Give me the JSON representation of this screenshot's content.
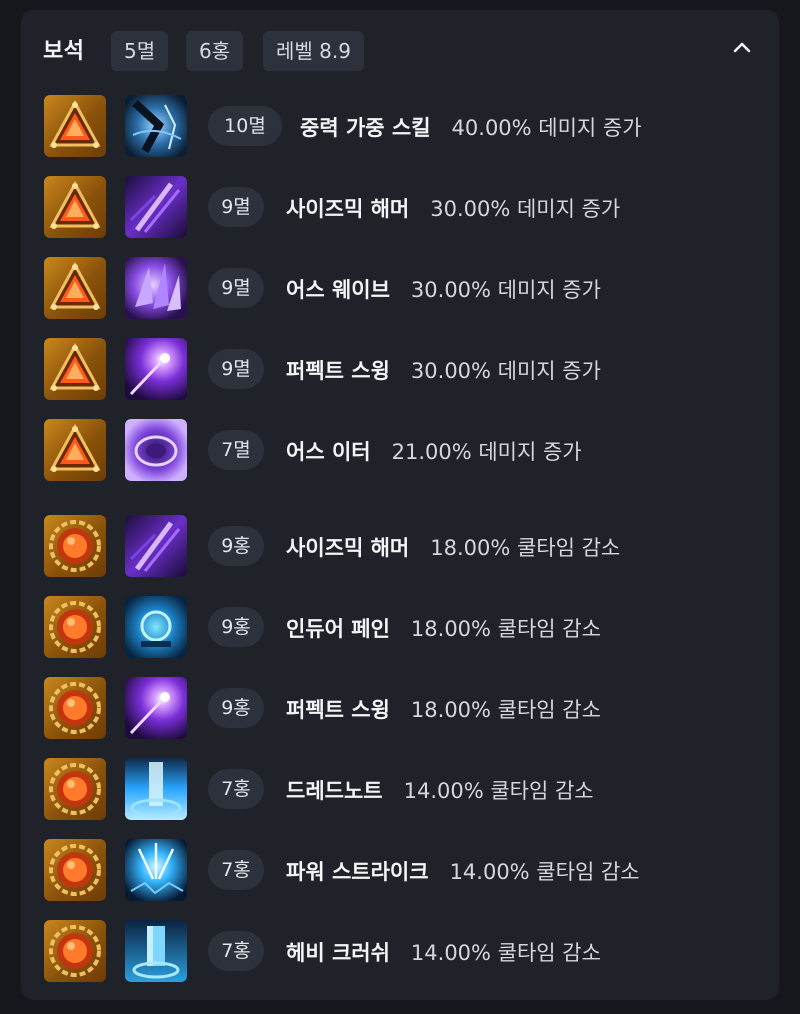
{
  "header": {
    "title": "보석",
    "chips": [
      "5멸",
      "6홍",
      "레벨 8.9"
    ]
  },
  "gems": [
    {
      "type": "damage",
      "gem_level": "10멸",
      "skill": "중력 가중 스킬",
      "effect": "40.00% 데미지 증가",
      "skill_icon": "gravity-skill-icon"
    },
    {
      "type": "damage",
      "gem_level": "9멸",
      "skill": "사이즈믹 해머",
      "effect": "30.00% 데미지 증가",
      "skill_icon": "seismic-hammer-icon"
    },
    {
      "type": "damage",
      "gem_level": "9멸",
      "skill": "어스 웨이브",
      "effect": "30.00% 데미지 증가",
      "skill_icon": "earth-wave-icon"
    },
    {
      "type": "damage",
      "gem_level": "9멸",
      "skill": "퍼펙트 스윙",
      "effect": "30.00% 데미지 증가",
      "skill_icon": "perfect-swing-icon"
    },
    {
      "type": "damage",
      "gem_level": "7멸",
      "skill": "어스 이터",
      "effect": "21.00% 데미지 증가",
      "skill_icon": "earth-eater-icon"
    },
    {
      "type": "cooldown",
      "gem_level": "9홍",
      "skill": "사이즈믹 해머",
      "effect": "18.00% 쿨타임 감소",
      "skill_icon": "seismic-hammer-icon"
    },
    {
      "type": "cooldown",
      "gem_level": "9홍",
      "skill": "인듀어 페인",
      "effect": "18.00% 쿨타임 감소",
      "skill_icon": "endure-pain-icon"
    },
    {
      "type": "cooldown",
      "gem_level": "9홍",
      "skill": "퍼펙트 스윙",
      "effect": "18.00% 쿨타임 감소",
      "skill_icon": "perfect-swing-icon"
    },
    {
      "type": "cooldown",
      "gem_level": "7홍",
      "skill": "드레드노트",
      "effect": "14.00% 쿨타임 감소",
      "skill_icon": "dreadnought-icon"
    },
    {
      "type": "cooldown",
      "gem_level": "7홍",
      "skill": "파워 스트라이크",
      "effect": "14.00% 쿨타임 감소",
      "skill_icon": "power-strike-icon"
    },
    {
      "type": "cooldown",
      "gem_level": "7홍",
      "skill": "헤비 크러쉬",
      "effect": "14.00% 쿨타임 감소",
      "skill_icon": "heavy-crush-icon"
    }
  ],
  "colors": {
    "panel_bg": "#1f2229",
    "chip_bg": "#2c313b",
    "gem_bg": "#b07018",
    "damage_gem": "#ff5a1a",
    "cooldown_gem": "#e0461a"
  }
}
